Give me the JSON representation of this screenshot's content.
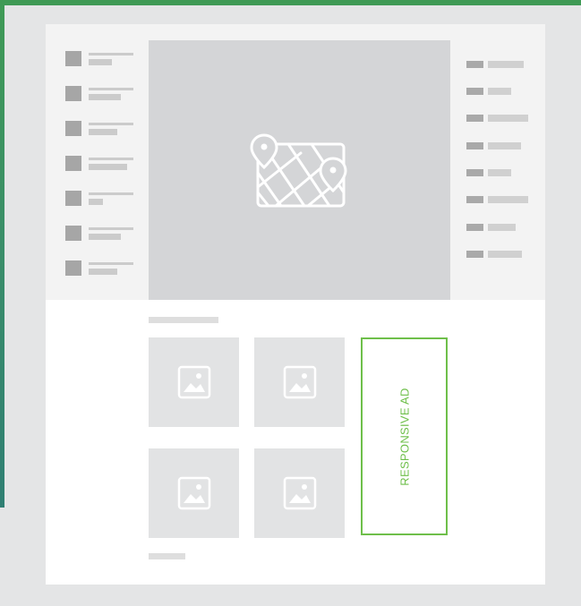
{
  "page": {
    "background_color": "#e4e5e6",
    "accent_green": "#6ebf4a",
    "backdrop_gradient": [
      "#3f9a55",
      "#2f7f73"
    ]
  },
  "left_sidebar": {
    "items": [
      {
        "icon": "placeholder-square-icon"
      },
      {
        "icon": "placeholder-square-icon"
      },
      {
        "icon": "placeholder-square-icon"
      },
      {
        "icon": "placeholder-square-icon"
      },
      {
        "icon": "placeholder-square-icon"
      },
      {
        "icon": "placeholder-square-icon"
      },
      {
        "icon": "placeholder-square-icon"
      }
    ]
  },
  "map": {
    "icon": "map-with-pins-icon"
  },
  "right_sidebar": {
    "items": [
      {},
      {},
      {},
      {},
      {},
      {},
      {},
      {}
    ]
  },
  "gallery": {
    "thumbnails": [
      {
        "icon": "image-icon"
      },
      {
        "icon": "image-icon"
      },
      {
        "icon": "image-icon"
      },
      {
        "icon": "image-icon"
      }
    ]
  },
  "ad": {
    "label": "RESPONSIVE AD"
  }
}
